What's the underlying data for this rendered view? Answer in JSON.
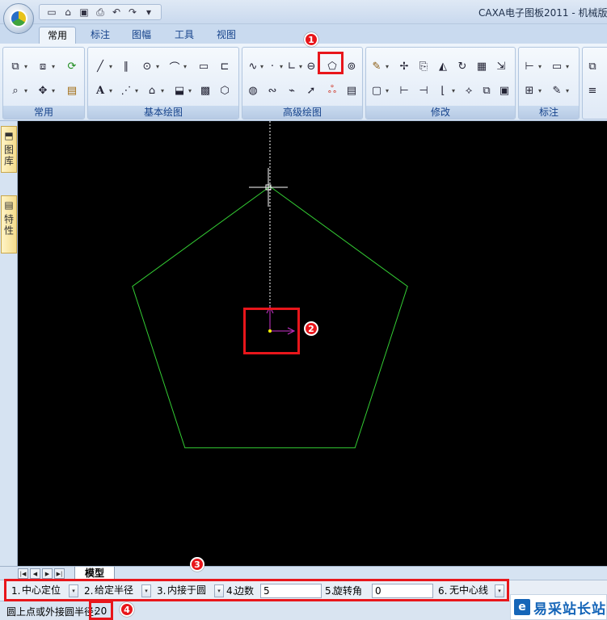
{
  "window": {
    "title": "CAXA电子图板2011 - 机械版"
  },
  "tabs": [
    {
      "label": "常用",
      "active": true
    },
    {
      "label": "标注"
    },
    {
      "label": "图幅"
    },
    {
      "label": "工具"
    },
    {
      "label": "视图"
    }
  ],
  "ribbon": {
    "groups": [
      {
        "label": "常用"
      },
      {
        "label": "基本绘图"
      },
      {
        "label": "高级绘图"
      },
      {
        "label": "修改"
      },
      {
        "label": "标注"
      }
    ]
  },
  "sidepanel": {
    "tabs": [
      {
        "label": "图库"
      },
      {
        "label": "特性"
      }
    ]
  },
  "sheets": {
    "active": "模型"
  },
  "propbar": {
    "items": [
      {
        "num": "1.",
        "value": "中心定位"
      },
      {
        "num": "2.",
        "value": "给定半径"
      },
      {
        "num": "3.",
        "value": "内接于圆"
      },
      {
        "num": "4.",
        "label": "边数",
        "value": "5"
      },
      {
        "num": "5.",
        "label": "旋转角",
        "value": "0"
      },
      {
        "num": "6.",
        "value": "无中心线"
      }
    ]
  },
  "status": {
    "prompt": "圆上点或外接圆半径:",
    "value": "20"
  },
  "drawing": {
    "polygon_sides": 5,
    "polygon_color": "#33cc33",
    "guide_color": "#ffffff",
    "axis_color": "#cc33cc"
  },
  "annotations": [
    {
      "label": "1"
    },
    {
      "label": "2"
    },
    {
      "label": "3"
    },
    {
      "label": "4"
    }
  ],
  "watermark": {
    "text": "易采站长站"
  },
  "colors": {
    "accent_red": "#e8161b",
    "ribbon_text": "#15428b"
  }
}
